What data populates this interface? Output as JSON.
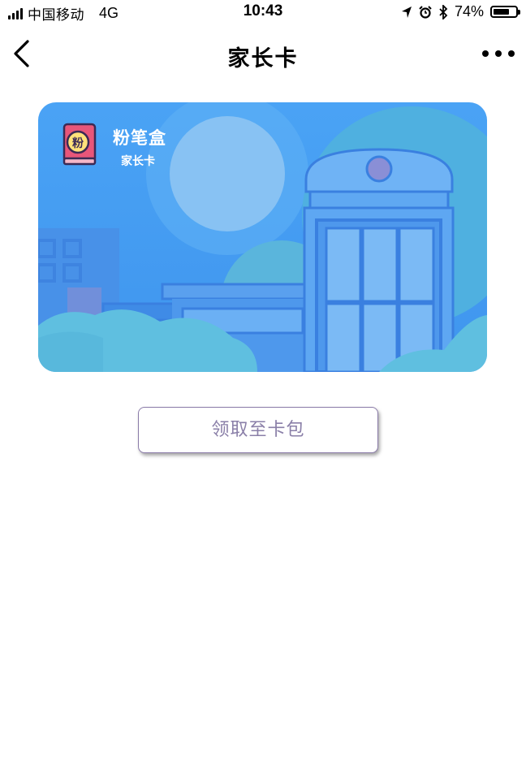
{
  "status_bar": {
    "carrier": "中国移动",
    "network": "4G",
    "time": "10:43",
    "battery_percent": "74%",
    "battery_level": 0.74,
    "icons": [
      "location-icon",
      "alarm-icon",
      "bluetooth-icon"
    ]
  },
  "nav": {
    "title": "家长卡",
    "back_icon": "chevron-left-icon",
    "more_icon": "more-dots-icon"
  },
  "card": {
    "logo_char": "粉",
    "brand": "粉笔盒",
    "subtitle": "家长卡",
    "colors": {
      "background": "#4aa3f5",
      "accent": "#e8567a"
    }
  },
  "actions": {
    "add_to_wallet_label": "领取至卡包"
  }
}
